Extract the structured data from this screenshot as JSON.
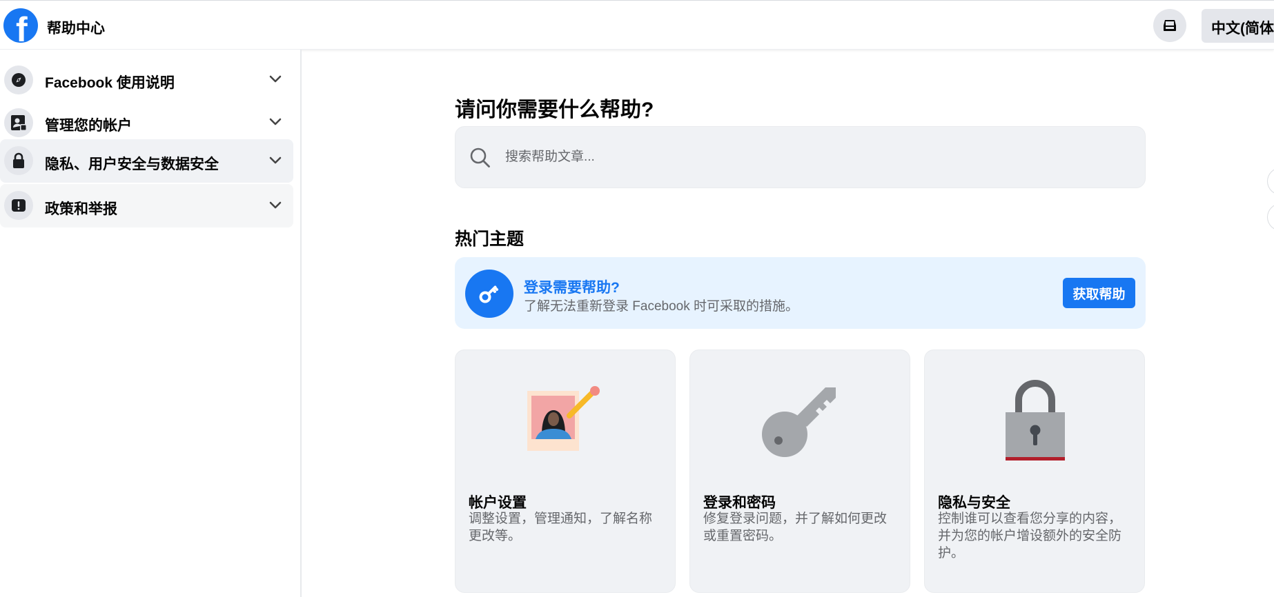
{
  "header": {
    "brand_title": "帮助中心",
    "logo_letter": "f",
    "language_label": "中文(简体)",
    "inbox_icon": "inbox-icon",
    "accent_color": "#1877f2"
  },
  "sidebar": {
    "items": [
      {
        "label": "Facebook 使用说明",
        "icon": "compass-icon"
      },
      {
        "label": "管理您的帐户",
        "icon": "account-icon"
      },
      {
        "label": "隐私、用户安全与数据安全",
        "icon": "lock-icon"
      },
      {
        "label": "政策和举报",
        "icon": "alert-icon"
      }
    ]
  },
  "main": {
    "title": "请问你需要什么帮助?",
    "search": {
      "placeholder": "搜索帮助文章...",
      "value": ""
    },
    "section_title": "热门主题",
    "banner": {
      "title": "登录需要帮助?",
      "description": "了解无法重新登录 Facebook 时可采取的措施。",
      "button_label": "获取帮助"
    },
    "cards": [
      {
        "title": "帐户设置",
        "description": "调整设置，管理通知，了解名称更改等。",
        "illustration": "profile-photo-pencil"
      },
      {
        "title": "登录和密码",
        "description": "修复登录问题，并了解如何更改或重置密码。",
        "illustration": "key"
      },
      {
        "title": "隐私与安全",
        "description": "控制谁可以查看您分享的内容，并为您的帐户增设额外的安全防护。",
        "illustration": "padlock"
      }
    ]
  }
}
